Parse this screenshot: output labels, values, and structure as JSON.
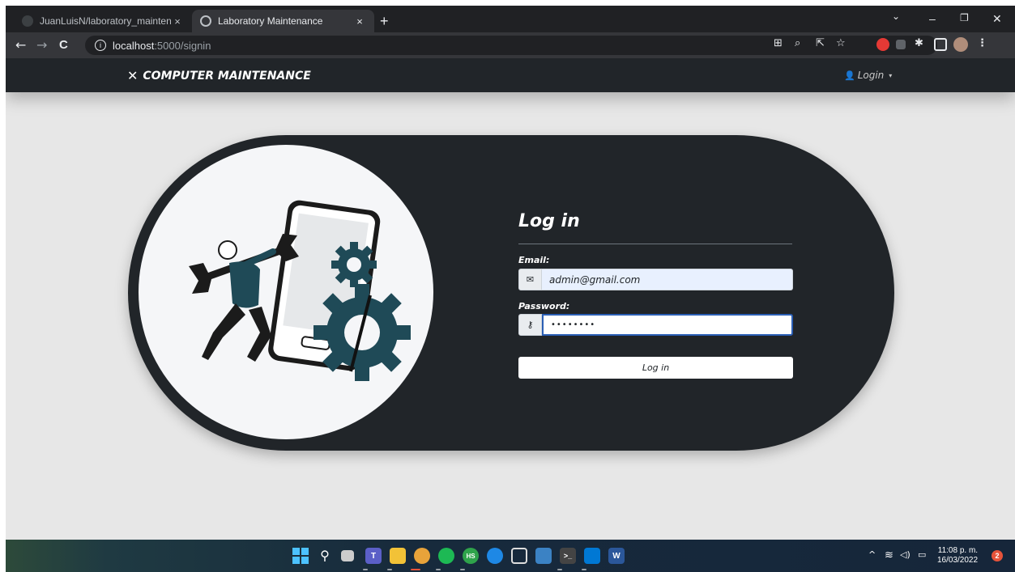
{
  "browser": {
    "tabs": [
      {
        "title": "JuanLuisN/laboratory_maintenan",
        "close": "×"
      },
      {
        "title": "Laboratory Maintenance",
        "close": "×"
      }
    ],
    "new_tab": "+",
    "window_controls": {
      "minimize": "–",
      "restore": "❐",
      "close": "✕",
      "chevron": "⌄"
    },
    "nav": {
      "back": "←",
      "forward": "→",
      "reload": "C"
    },
    "address": {
      "host": "localhost",
      "path": ":5000/signin"
    }
  },
  "navbar": {
    "brand_icon": "✕",
    "brand": "COMPUTER MAINTENANCE",
    "login_menu": "Login",
    "login_caret": "▾"
  },
  "form": {
    "title": "Log in",
    "email_label": "Email:",
    "email_value": "admin@gmail.com",
    "password_label": "Password:",
    "password_value": "••••••••",
    "submit": "Log in",
    "email_icon": "envelope-icon",
    "password_icon": "key-icon"
  },
  "taskbar": {
    "time": "11:08 p. m.",
    "date": "16/03/2022",
    "notifications": "2",
    "tray_chevron": "^"
  }
}
